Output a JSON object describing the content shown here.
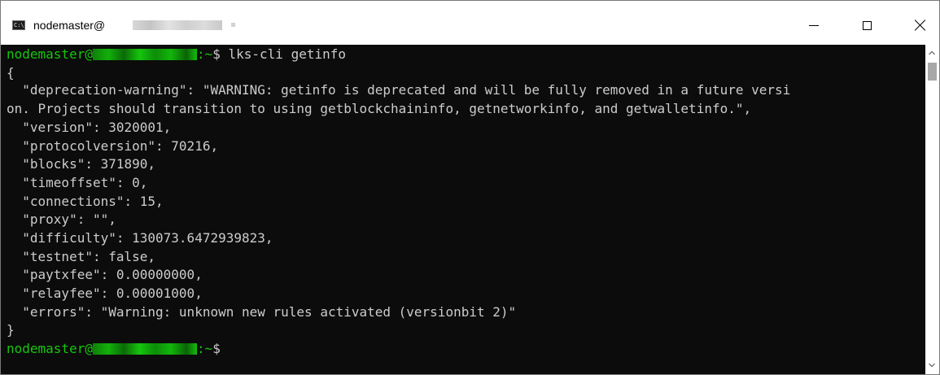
{
  "window": {
    "title_prefix": "nodemaster@",
    "app_icon_text": "C:\\",
    "app_icon": "console-window-icon",
    "controls": {
      "minimize": "minimize-icon",
      "maximize": "maximize-icon",
      "close": "close-icon"
    }
  },
  "terminal": {
    "prompt_user": "nodemaster@",
    "prompt_suffix": ":~",
    "command_line": "$ lks-cli getinfo",
    "output": [
      "{",
      "  \"deprecation-warning\": \"WARNING: getinfo is deprecated and will be fully removed in a future versi",
      "on. Projects should transition to using getblockchaininfo, getnetworkinfo, and getwalletinfo.\",",
      "  \"version\": 3020001,",
      "  \"protocolversion\": 70216,",
      "  \"blocks\": 371890,",
      "  \"timeoffset\": 0,",
      "  \"connections\": 15,",
      "  \"proxy\": \"\",",
      "  \"difficulty\": 130073.6472939823,",
      "  \"testnet\": false,",
      "  \"paytxfee\": 0.00000000,",
      "  \"relayfee\": 0.00001000,",
      "  \"errors\": \"Warning: unknown new rules activated (versionbit 2)\"",
      "}"
    ],
    "final_prompt": "$"
  },
  "colors": {
    "console_background": "#0c0c0c",
    "console_text": "#cccccc",
    "prompt_green": "#16c60c",
    "titlebar_background": "#ffffff"
  },
  "scrollbar": {
    "up_icon": "scroll-up-arrow-icon",
    "down_icon": "scroll-down-arrow-icon"
  }
}
